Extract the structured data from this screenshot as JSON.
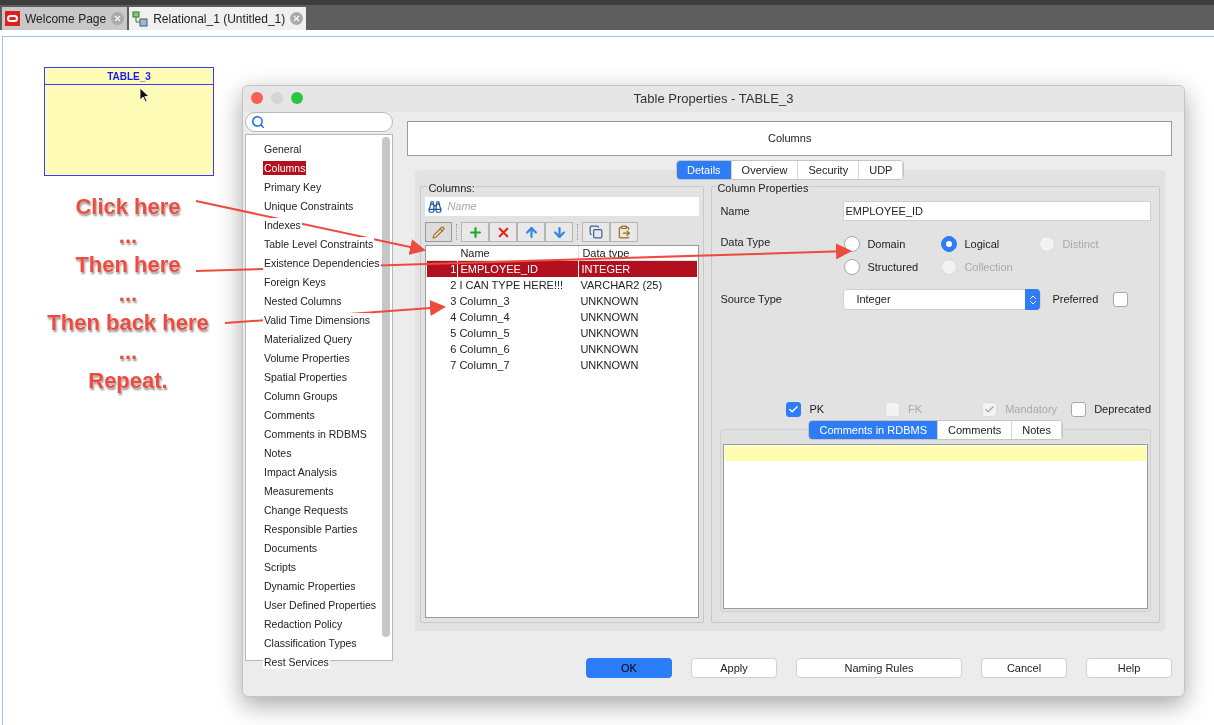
{
  "tabs": [
    {
      "label": "Welcome Page",
      "selected": false
    },
    {
      "label": "Relational_1 (Untitled_1)",
      "selected": true
    }
  ],
  "diagram": {
    "table_name": "TABLE_3"
  },
  "annotations": [
    "Click here",
    "...",
    "Then here",
    "...",
    "Then back here",
    "...",
    "Repeat."
  ],
  "dialog": {
    "title": "Table Properties - TABLE_3",
    "nav": [
      {
        "label": "General",
        "selected": false
      },
      {
        "label": "Columns",
        "selected": true
      },
      {
        "label": "Primary Key",
        "selected": false
      },
      {
        "label": "Unique Constraints",
        "selected": false
      },
      {
        "label": "Indexes",
        "selected": false
      },
      {
        "label": "Table Level Constraints",
        "selected": false
      },
      {
        "label": "Existence Dependencies",
        "selected": false
      },
      {
        "label": "Foreign Keys",
        "selected": false
      },
      {
        "label": "Nested Columns",
        "selected": false
      },
      {
        "label": "Valid Time Dimensions",
        "selected": false
      },
      {
        "label": "Materialized Query",
        "selected": false
      },
      {
        "label": "Volume Properties",
        "selected": false
      },
      {
        "label": "Spatial Properties",
        "selected": false
      },
      {
        "label": "Column Groups",
        "selected": false
      },
      {
        "label": "Comments",
        "selected": false
      },
      {
        "label": "Comments in RDBMS",
        "selected": false
      },
      {
        "label": "Notes",
        "selected": false
      },
      {
        "label": "Impact Analysis",
        "selected": false
      },
      {
        "label": "Measurements",
        "selected": false
      },
      {
        "label": "Change Requests",
        "selected": false
      },
      {
        "label": "Responsible Parties",
        "selected": false
      },
      {
        "label": "Documents",
        "selected": false
      },
      {
        "label": "Scripts",
        "selected": false
      },
      {
        "label": "Dynamic Properties",
        "selected": false
      },
      {
        "label": "User Defined Properties",
        "selected": false
      },
      {
        "label": "Redaction Policy",
        "selected": false
      },
      {
        "label": "Classification Types",
        "selected": false
      },
      {
        "label": "Rest Services",
        "selected": false
      }
    ],
    "page_title": "Columns",
    "tabs": [
      {
        "label": "Details",
        "selected": true
      },
      {
        "label": "Overview",
        "selected": false
      },
      {
        "label": "Security",
        "selected": false
      },
      {
        "label": "UDP",
        "selected": false
      }
    ],
    "columns": {
      "title": "Columns:",
      "filter_placeholder": "Name",
      "headers": [
        "Name",
        "Data type"
      ],
      "rows": [
        {
          "number": "1",
          "name": "EMPLOYEE_ID",
          "type": "INTEGER",
          "selected": true
        },
        {
          "number": "2",
          "name": "I CAN TYPE HERE!!!",
          "type": "VARCHAR2 (25)",
          "selected": false
        },
        {
          "number": "3",
          "name": "Column_3",
          "type": "UNKNOWN",
          "selected": false
        },
        {
          "number": "4",
          "name": "Column_4",
          "type": "UNKNOWN",
          "selected": false
        },
        {
          "number": "5",
          "name": "Column_5",
          "type": "UNKNOWN",
          "selected": false
        },
        {
          "number": "6",
          "name": "Column_6",
          "type": "UNKNOWN",
          "selected": false
        },
        {
          "number": "7",
          "name": "Column_7",
          "type": "UNKNOWN",
          "selected": false
        }
      ]
    },
    "column_properties": {
      "title": "Column Properties",
      "name_label": "Name",
      "name_value": "EMPLOYEE_ID",
      "data_type_label": "Data Type",
      "data_types": [
        {
          "label": "Domain",
          "selected": false,
          "disabled": false
        },
        {
          "label": "Logical",
          "selected": true,
          "disabled": false
        },
        {
          "label": "Distinct",
          "selected": false,
          "disabled": true
        },
        {
          "label": "Structured",
          "selected": false,
          "disabled": false
        },
        {
          "label": "Collection",
          "selected": false,
          "disabled": true
        }
      ],
      "source_type_label": "Source Type",
      "source_type_value": "Integer",
      "preferred": {
        "label": "Preferred",
        "checked": false
      },
      "flags": [
        {
          "label": "PK",
          "checked": true,
          "disabled": false
        },
        {
          "label": "FK",
          "checked": false,
          "disabled": true
        },
        {
          "label": "Mandatory",
          "checked": true,
          "disabled": true
        },
        {
          "label": "Deprecated",
          "checked": false,
          "disabled": false
        }
      ],
      "comment_tabs": [
        {
          "label": "Comments in RDBMS",
          "selected": true
        },
        {
          "label": "Comments",
          "selected": false
        },
        {
          "label": "Notes",
          "selected": false
        }
      ]
    },
    "buttons": [
      {
        "label": "OK",
        "default": true
      },
      {
        "label": "Apply",
        "default": false
      },
      {
        "label": "Naming Rules",
        "default": false
      },
      {
        "label": "Cancel",
        "default": false
      },
      {
        "label": "Help",
        "default": false
      }
    ]
  }
}
